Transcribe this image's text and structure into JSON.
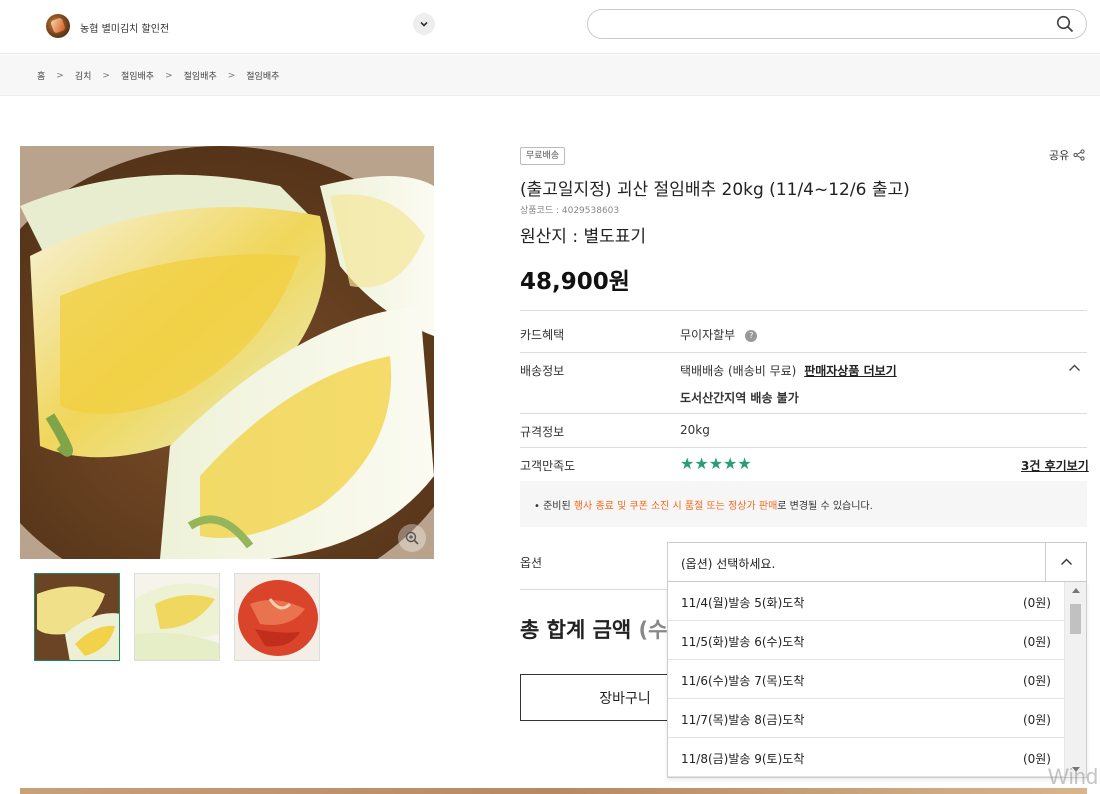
{
  "header": {
    "store_name": "농협 별미김치 할인전",
    "search_placeholder": ""
  },
  "breadcrumb": [
    "홈",
    "김치",
    "절임배추",
    "절임배추",
    "절임배추"
  ],
  "product": {
    "badge": "무료배송",
    "share_label": "공유",
    "title": "(출고일지정) 괴산 절임배추 20kg (11/4~12/6 출고)",
    "code": "상품코드 : 4029538603",
    "origin": "원산지 : 별도표기",
    "price": "48,900원"
  },
  "info": {
    "card_label": "카드혜택",
    "card_value": "무이자할부",
    "shipping_label": "배송정보",
    "shipping_value": "택배배송  (배송비 무료)",
    "seller_more": "판매자상품 더보기",
    "shipping_note": "도서산간지역 배송 불가",
    "spec_label": "규격정보",
    "spec_value": "20kg",
    "satisfaction_label": "고객만족도",
    "stars": "★★★★★",
    "reviews_link": "3건 후기보기",
    "rating": 5
  },
  "notice": {
    "prefix": "• 준비된 ",
    "highlight": "행사 종료 및 쿠폰 소진 시 품절 또는 정상가 판매",
    "suffix": "로 변경될 수 있습니다."
  },
  "option": {
    "label": "옵션",
    "selected": "(옵션) 선택하세요.",
    "items": [
      {
        "name": "11/4(월)발송 5(화)도착",
        "price": "(0원)"
      },
      {
        "name": "11/5(화)발송 6(수)도착",
        "price": "(0원)"
      },
      {
        "name": "11/6(수)발송 7(목)도착",
        "price": "(0원)"
      },
      {
        "name": "11/7(목)발송 8(금)도착",
        "price": "(0원)"
      },
      {
        "name": "11/8(금)발송 9(토)도착",
        "price": "(0원)"
      }
    ]
  },
  "total": {
    "label": "총 합계 금액",
    "paren": "(수"
  },
  "cart_button": "장바구니",
  "watermark": "Wind",
  "colors": {
    "accent_green": "#2a9d78",
    "highlight_orange": "#f26b1d"
  }
}
